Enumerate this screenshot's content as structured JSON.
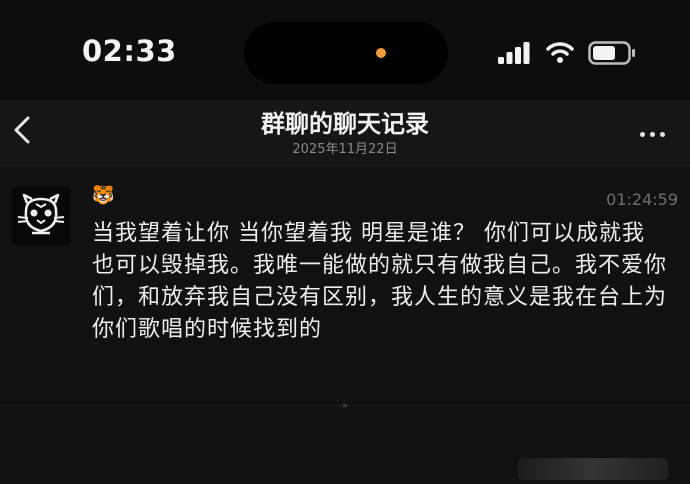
{
  "status_bar": {
    "time": "02:33",
    "icons": [
      "signal-icon",
      "wifi-icon",
      "battery-icon"
    ],
    "recording_dot_color": "#f39a3c"
  },
  "header": {
    "back_icon": "chevron-left-icon",
    "title": "群聊的聊天记录",
    "date": "2025年11月22日",
    "more_icon": "more-horizontal-icon"
  },
  "message": {
    "avatar_icon": "tiger-avatar-icon",
    "sender_emoji": "🐯",
    "time": "01:24:59",
    "text": "当我望着让你 当你望着我 明星是谁？ 你们可以成就我 也可以毁掉我。我唯一能做的就只有做我自己。我不爱你们，和放弃我自己没有区别，我人生的意义是我在台上为你们歌唱的时候找到的"
  },
  "colors": {
    "background": "#111111",
    "header_background": "#161616",
    "text": "#eeeeee",
    "muted": "#8a8a8a"
  }
}
